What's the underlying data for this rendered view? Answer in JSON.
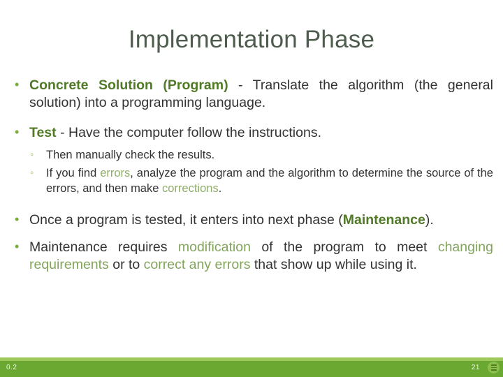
{
  "slide": {
    "title": "Implementation Phase",
    "bullets": [
      {
        "id": "concrete-solution",
        "keyword": "Concrete Solution (Program)",
        "rest": " - Translate the algorithm (the general solution) into a programming language."
      },
      {
        "id": "test",
        "keyword": "Test",
        "rest": " - Have the computer follow the instructions."
      }
    ],
    "sub_bullets": [
      {
        "id": "manual-check",
        "text": "Then manually check the results."
      },
      {
        "id": "find-errors",
        "part1": "If you find ",
        "kw1": "errors",
        "part2": ", analyze the program and the algorithm to determine the source of the errors, and then make ",
        "kw2": "corrections",
        "part3": "."
      }
    ],
    "bullet_tested": {
      "id": "once-tested",
      "part1": "Once a program is tested, it enters into next phase (",
      "kw1": "Maintenance",
      "part2": ")."
    },
    "bullet_maintenance": {
      "id": "maintenance-requires",
      "part1": "Maintenance requires ",
      "kw1": "modification",
      "part2": " of the program to meet ",
      "kw2": "changing requirements",
      "part3": " or to ",
      "kw3": "correct any errors",
      "part4": " that show up while using it."
    }
  },
  "footer": {
    "left_label": "0.2",
    "page_number": "21",
    "icon": "menu-circle-icon"
  },
  "colors": {
    "title": "#4e5c4e",
    "body_text": "#333333",
    "keyword_bold_green": "#507a26",
    "keyword_green": "#82a45c",
    "bullet_green": "#7aad3a",
    "footer_bar": "#6aa832",
    "footer_strip": "#9ec85a"
  }
}
